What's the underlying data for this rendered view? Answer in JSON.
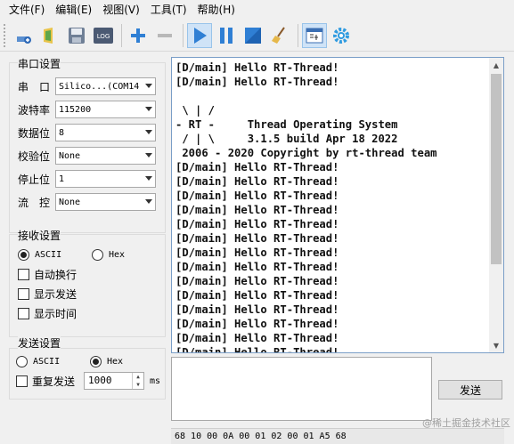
{
  "menu": [
    "文件(F)",
    "编辑(E)",
    "视图(V)",
    "工具(T)",
    "帮助(H)"
  ],
  "toolbar": {
    "icons": [
      "new-icon",
      "open-icon",
      "save-icon",
      "log-icon",
      "add-icon",
      "remove-icon",
      "play-icon",
      "pause-icon",
      "stop-icon",
      "clear-icon",
      "window-icon",
      "settings-icon"
    ],
    "log_label": "LOG"
  },
  "serial": {
    "title": "串口设置",
    "fields": [
      {
        "label": "串　口",
        "value": "Silico...(COM14"
      },
      {
        "label": "波特率",
        "value": "115200"
      },
      {
        "label": "数据位",
        "value": "8"
      },
      {
        "label": "校验位",
        "value": "None"
      },
      {
        "label": "停止位",
        "value": "1"
      },
      {
        "label": "流　控",
        "value": "None"
      }
    ]
  },
  "receive": {
    "title": "接收设置",
    "ascii": "ASCII",
    "hex": "Hex",
    "selected": "ASCII",
    "options": [
      "自动换行",
      "显示发送",
      "显示时间"
    ]
  },
  "send": {
    "title": "发送设置",
    "ascii": "ASCII",
    "hex": "Hex",
    "selected": "Hex",
    "repeat_label": "重复发送",
    "interval": "1000",
    "unit": "ms",
    "button": "发送"
  },
  "terminal": {
    "lines": [
      "[D/main] Hello RT-Thread!",
      "[D/main] Hello RT-Thread!",
      "",
      " \\ | /",
      "- RT -     Thread Operating System",
      " / | \\     3.1.5 build Apr 18 2022",
      " 2006 - 2020 Copyright by rt-thread team",
      "[D/main] Hello RT-Thread!",
      "[D/main] Hello RT-Thread!",
      "[D/main] Hello RT-Thread!",
      "[D/main] Hello RT-Thread!",
      "[D/main] Hello RT-Thread!",
      "[D/main] Hello RT-Thread!",
      "[D/main] Hello RT-Thread!",
      "[D/main] Hello RT-Thread!",
      "[D/main] Hello RT-Thread!",
      "[D/main] Hello RT-Thread!",
      "[D/main] Hello RT-Thread!",
      "[D/main] Hello RT-Thread!",
      "[D/main] Hello RT-Thread!",
      "[D/main] Hello RT-Thread!"
    ]
  },
  "status": "68 10 00 0A 00 01 02 00 01 A5 68",
  "watermark": "@稀土掘金技术社区"
}
